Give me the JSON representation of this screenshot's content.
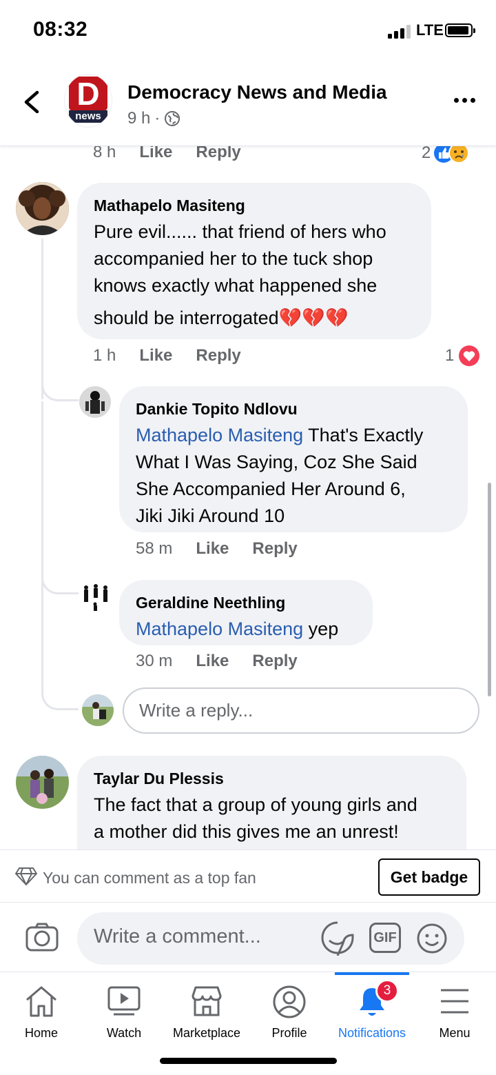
{
  "status": {
    "time": "08:32",
    "network": "LTE"
  },
  "header": {
    "logo_letter": "D",
    "logo_word": "news",
    "page_name": "Democracy News and Media",
    "post_age": "9 h",
    "dot": "·"
  },
  "prev_comment": {
    "time": "8 h",
    "like": "Like",
    "reply": "Reply",
    "reaction_count": "2"
  },
  "comments": [
    {
      "author": "Mathapelo Masiteng",
      "text_lines": [
        "Pure evil...... that friend of hers who",
        "accompanied her to the tuck shop",
        "knows exactly what happened she",
        "should be interrogated"
      ],
      "emoji": "💔💔💔",
      "time": "1 h",
      "like": "Like",
      "reply": "Reply",
      "reaction_count": "1"
    },
    {
      "author": "Dankie Topito Ndlovu",
      "mention": "Mathapelo Masiteng",
      "text_lines": [
        "That's Exactly",
        "What I Was Saying, Coz She Said",
        "She Accompanied Her Around 6,",
        "Jiki Jiki Around 10"
      ],
      "time": "58 m",
      "like": "Like",
      "reply": "Reply"
    },
    {
      "author": "Geraldine Neethling",
      "mention": "Mathapelo Masiteng",
      "text": "yep",
      "time": "30 m",
      "like": "Like",
      "reply": "Reply"
    },
    {
      "author": "Taylar Du Plessis",
      "text_lines": [
        "The fact that a group of young girls and",
        "a mother did this gives me an unrest!"
      ]
    }
  ],
  "reply_placeholder": "Write a reply...",
  "top_fan": {
    "text": "You can comment as a top fan",
    "button": "Get badge"
  },
  "composer": {
    "placeholder": "Write a comment...",
    "gif": "GIF"
  },
  "tabs": [
    {
      "label": "Home",
      "icon": "home-icon"
    },
    {
      "label": "Watch",
      "icon": "watch-icon"
    },
    {
      "label": "Marketplace",
      "icon": "marketplace-icon"
    },
    {
      "label": "Profile",
      "icon": "profile-icon"
    },
    {
      "label": "Notifications",
      "icon": "bell-icon",
      "badge": "3",
      "active": true
    },
    {
      "label": "Menu",
      "icon": "menu-icon"
    }
  ],
  "colors": {
    "accent": "#1877f2",
    "mention": "#2a5db0",
    "bubble": "#f0f2f5",
    "heart": "#f33e58",
    "badge": "#e41e3f"
  }
}
